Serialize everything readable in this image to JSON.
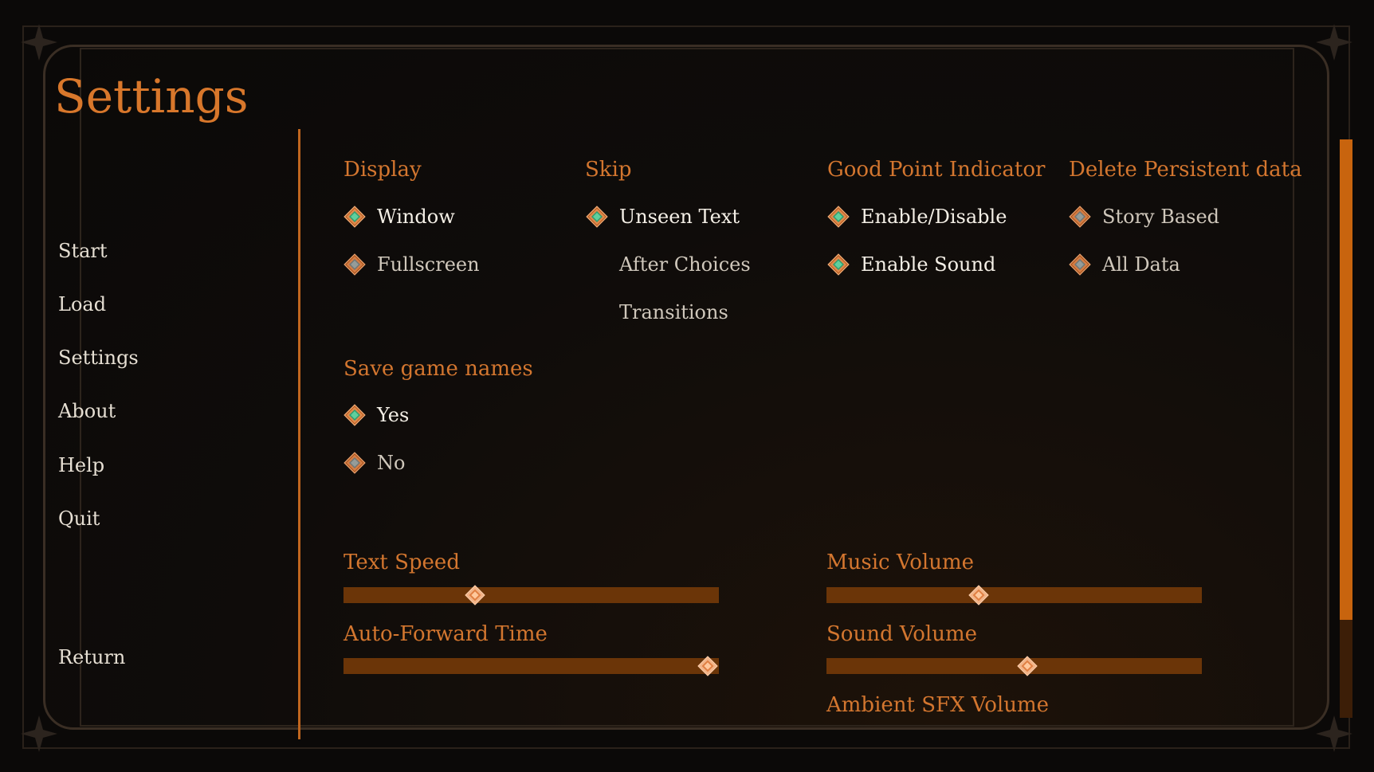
{
  "title": "Settings",
  "nav": {
    "start": "Start",
    "load": "Load",
    "settings": "Settings",
    "about": "About",
    "help": "Help",
    "quit": "Quit",
    "return": "Return"
  },
  "display": {
    "heading": "Display",
    "options": [
      {
        "label": "Window",
        "selected": true
      },
      {
        "label": "Fullscreen",
        "selected": false
      }
    ]
  },
  "skip": {
    "heading": "Skip",
    "options": [
      {
        "label": "Unseen Text",
        "selected": true
      },
      {
        "label": "After Choices",
        "selected": false
      },
      {
        "label": "Transitions",
        "selected": false
      }
    ]
  },
  "good_point": {
    "heading": "Good Point Indicator",
    "options": [
      {
        "label": "Enable/Disable",
        "selected": true
      },
      {
        "label": "Enable Sound",
        "selected": true
      }
    ]
  },
  "delete_data": {
    "heading": "Delete Persistent data",
    "options": [
      {
        "label": "Story Based"
      },
      {
        "label": "All Data"
      }
    ]
  },
  "save_names": {
    "heading": "Save game names",
    "options": [
      {
        "label": "Yes",
        "selected": true
      },
      {
        "label": "No",
        "selected": false
      }
    ]
  },
  "sliders": {
    "text_speed": {
      "label": "Text Speed",
      "value": 0.35
    },
    "auto_forward": {
      "label": "Auto-Forward Time",
      "value": 0.97
    },
    "music_volume": {
      "label": "Music Volume",
      "value": 0.406
    },
    "sound_volume": {
      "label": "Sound Volume",
      "value": 0.536
    },
    "ambient_sfx": {
      "label": "Ambient SFX Volume"
    }
  },
  "scrollbar": {
    "position": 0.0,
    "visible_fraction": 0.83
  },
  "colors": {
    "accent": "#d8772b",
    "text": "#e6dfd3",
    "slider_bar": "#6b3508",
    "gem_selected_center": "#2f9a6c",
    "gem_unselected_center": "#7d8583"
  },
  "icons": {
    "selected": "gem-selected-icon",
    "unselected": "gem-unselected-icon",
    "corner": "corner-star-ornament-icon"
  }
}
